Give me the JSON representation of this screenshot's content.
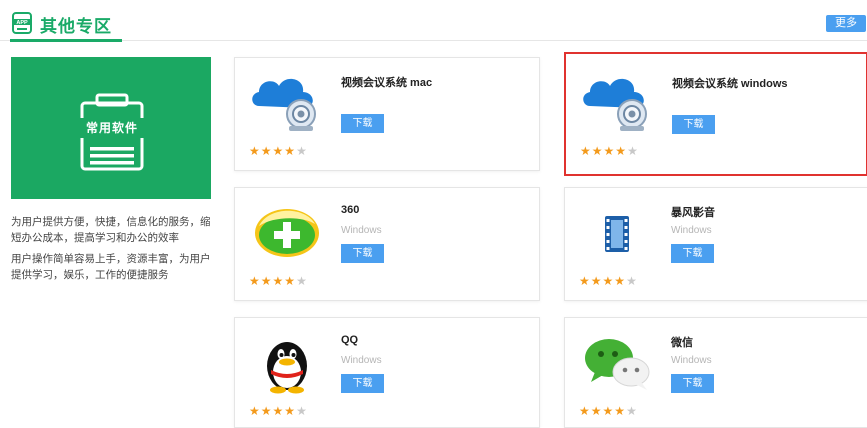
{
  "section": {
    "title": "其他专区",
    "more_label": "更多",
    "app_icon_text": "APP"
  },
  "promo": {
    "label": "常用软件",
    "desc1": "为用户提供方便，快捷，信息化的服务，缩短办公成本，提高学习和办公的效率",
    "desc2": "用户操作简单容易上手，资源丰富，为用户提供学习，娱乐，工作的便捷服务"
  },
  "apps": [
    {
      "name": "视频会议系统 mac",
      "platform": "",
      "download_label": "下载",
      "rating": 4,
      "rating_max": 5,
      "icon": "cloud-camera-icon"
    },
    {
      "name": "视频会议系统 windows",
      "platform": "",
      "download_label": "下载",
      "rating": 4,
      "rating_max": 5,
      "icon": "cloud-camera-icon",
      "selected": true
    },
    {
      "name": "360",
      "platform": "Windows",
      "download_label": "下载",
      "rating": 4,
      "rating_max": 5,
      "icon": "360-safe-icon"
    },
    {
      "name": "暴风影音",
      "platform": "Windows",
      "download_label": "下载",
      "rating": 4,
      "rating_max": 5,
      "icon": "film-strip-icon"
    },
    {
      "name": "QQ",
      "platform": "Windows",
      "download_label": "下载",
      "rating": 4,
      "rating_max": 5,
      "icon": "penguin-icon"
    },
    {
      "name": "微信",
      "platform": "Windows",
      "download_label": "下载",
      "rating": 4,
      "rating_max": 5,
      "icon": "wechat-icon"
    }
  ],
  "colors": {
    "accent_green": "#1aaa68",
    "button_blue": "#4a9ff0",
    "star_orange": "#f39a1c",
    "selected_border": "#e0322f"
  }
}
